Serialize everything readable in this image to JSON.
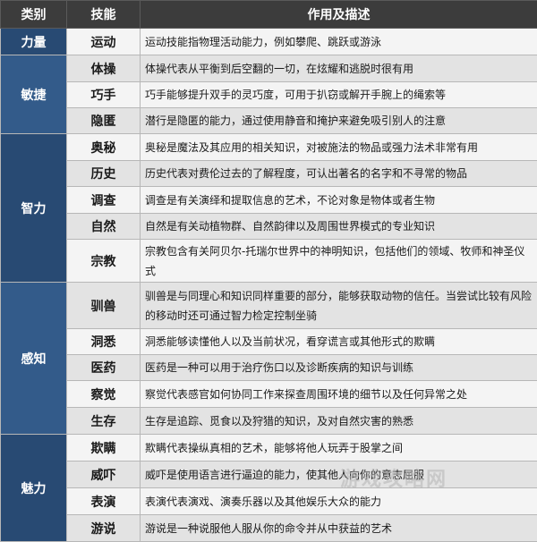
{
  "header": {
    "category": "类别",
    "skill": "技能",
    "description": "作用及描述"
  },
  "colors": {
    "category_bg": "#284a73",
    "category_alt_bg": "#335b8a",
    "row_bg": "#f4f4f4",
    "row_alt_bg": "#e3e3e3",
    "header_bg": "#3c3c3c"
  },
  "groups": [
    {
      "category": "力量",
      "rows": [
        {
          "skill": "运动",
          "desc": "运动技能指物理活动能力，例如攀爬、跳跃或游泳"
        }
      ]
    },
    {
      "category": "敏捷",
      "rows": [
        {
          "skill": "体操",
          "desc": "体操代表从平衡到后空翻的一切，在炫耀和逃脱时很有用"
        },
        {
          "skill": "巧手",
          "desc": "巧手能够提升双手的灵巧度，可用于扒窃或解开手腕上的绳索等"
        },
        {
          "skill": "隐匿",
          "desc": "潜行是隐匿的能力，通过使用静音和掩护来避免吸引别人的注意"
        }
      ]
    },
    {
      "category": "智力",
      "rows": [
        {
          "skill": "奥秘",
          "desc": "奥秘是魔法及其应用的相关知识，对被施法的物品或强力法术非常有用"
        },
        {
          "skill": "历史",
          "desc": "历史代表对费伦过去的了解程度，可认出著名的名字和不寻常的物品"
        },
        {
          "skill": "调查",
          "desc": "调查是有关演绎和提取信息的艺术，不论对象是物体或者生物"
        },
        {
          "skill": "自然",
          "desc": "自然是有关动植物群、自然韵律以及周围世界模式的专业知识"
        },
        {
          "skill": "宗教",
          "desc": "宗教包含有关阿贝尔-托瑞尔世界中的神明知识，包括他们的领域、牧师和神圣仪式"
        }
      ]
    },
    {
      "category": "感知",
      "rows": [
        {
          "skill": "驯兽",
          "desc": "驯兽是与同理心和知识同样重要的部分，能够获取动物的信任。当尝试比较有风险的移动时还可通过智力检定控制坐骑"
        },
        {
          "skill": "洞悉",
          "desc": "洞悉能够读懂他人以及当前状况，看穿谎言或其他形式的欺瞒"
        },
        {
          "skill": "医药",
          "desc": "医药是一种可以用于治疗伤口以及诊断疾病的知识与训练"
        },
        {
          "skill": "察觉",
          "desc": "察觉代表感官如何协同工作来探查周围环境的细节以及任何异常之处"
        },
        {
          "skill": "生存",
          "desc": "生存是追踪、觅食以及狩猎的知识，及对自然灾害的熟悉"
        }
      ]
    },
    {
      "category": "魅力",
      "rows": [
        {
          "skill": "欺瞒",
          "desc": "欺瞒代表操纵真相的艺术，能够将他人玩弄于股掌之间"
        },
        {
          "skill": "威吓",
          "desc": "威吓是使用语言进行逼迫的能力，使其他人向你的意志屈服"
        },
        {
          "skill": "表演",
          "desc": "表演代表演戏、演奏乐器以及其他娱乐大众的能力"
        },
        {
          "skill": "游说",
          "desc": "游说是一种说服他人服从你的命令并从中获益的艺术"
        }
      ]
    }
  ],
  "watermark": "游戏攻略网"
}
